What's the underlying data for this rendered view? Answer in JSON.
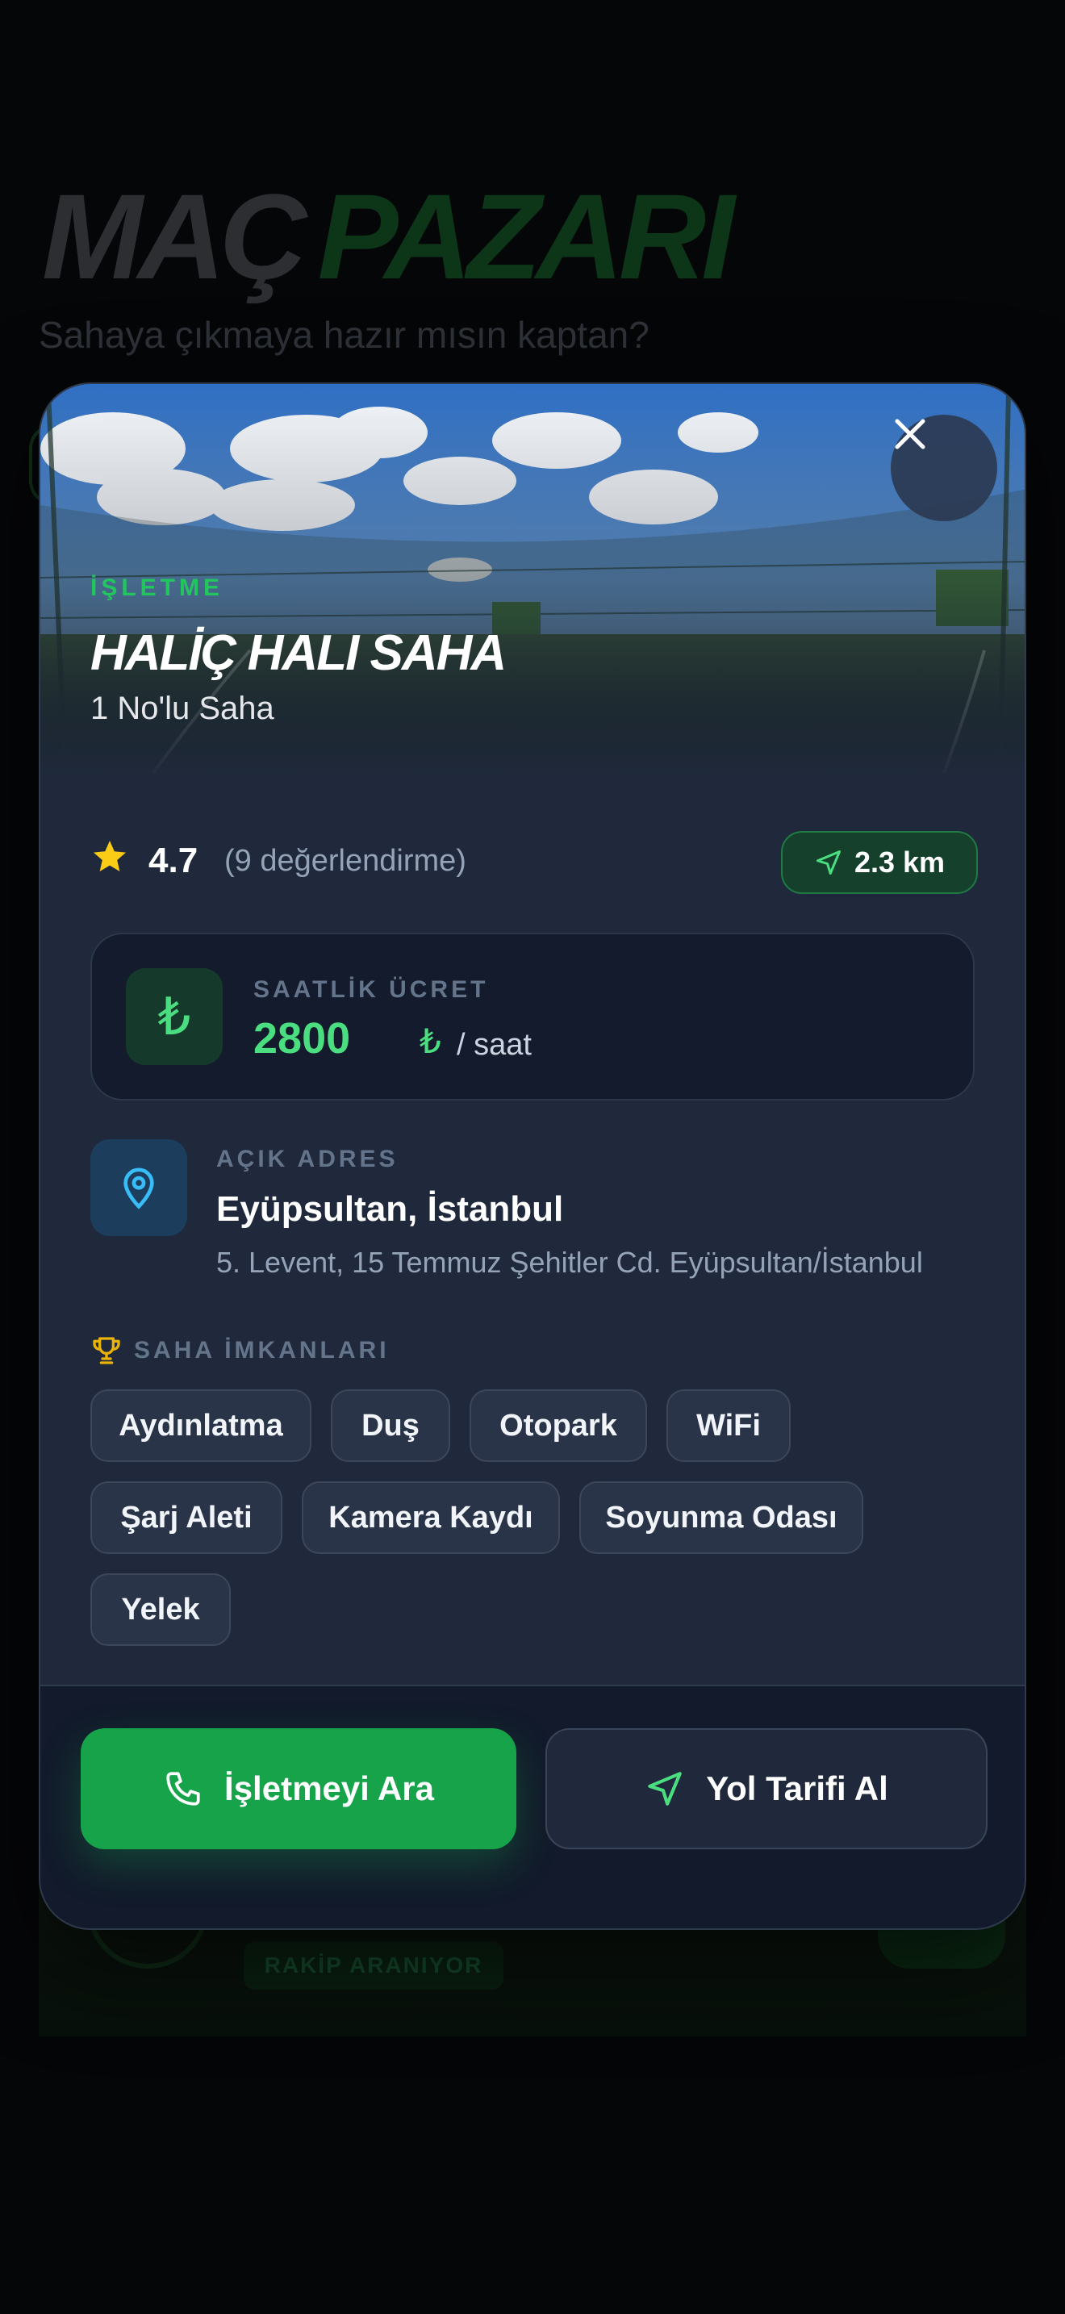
{
  "background": {
    "title_part1": "MAÇ",
    "title_part2": "PAZARI",
    "subtitle": "Sahaya çıkmaya hazır mısın kaptan?",
    "card_badge": "RAKİP ARANIYOR"
  },
  "modal": {
    "hero": {
      "label": "İŞLETME",
      "title": "HALİÇ HALI SAHA",
      "subtitle": "1 No'lu Saha"
    },
    "rating": {
      "value": "4.7",
      "count_text": "(9 değerlendirme)",
      "star_color": "#facc15"
    },
    "distance": "2.3 km",
    "price": {
      "label": "SAATLİK ÜCRET",
      "amount": "2800",
      "currency": "₺",
      "unit": "/ saat"
    },
    "address": {
      "label": "AÇIK ADRES",
      "city": "Eyüpsultan, İstanbul",
      "line": "5. Levent, 15 Temmuz Şehitler Cd. Eyüpsultan/İstanbul"
    },
    "amenities": {
      "title": "SAHA İMKANLARI",
      "items": [
        "Aydınlatma",
        "Duş",
        "Otopark",
        "WiFi",
        "Şarj Aleti",
        "Kamera Kaydı",
        "Soyunma Odası",
        "Yelek"
      ]
    },
    "actions": {
      "call_label": "İşletmeyi Ara",
      "directions_label": "Yol Tarifi Al"
    }
  },
  "colors": {
    "accent_green": "#22c55e",
    "primary_button": "#16a34a",
    "modal_bg": "#1f293b"
  }
}
